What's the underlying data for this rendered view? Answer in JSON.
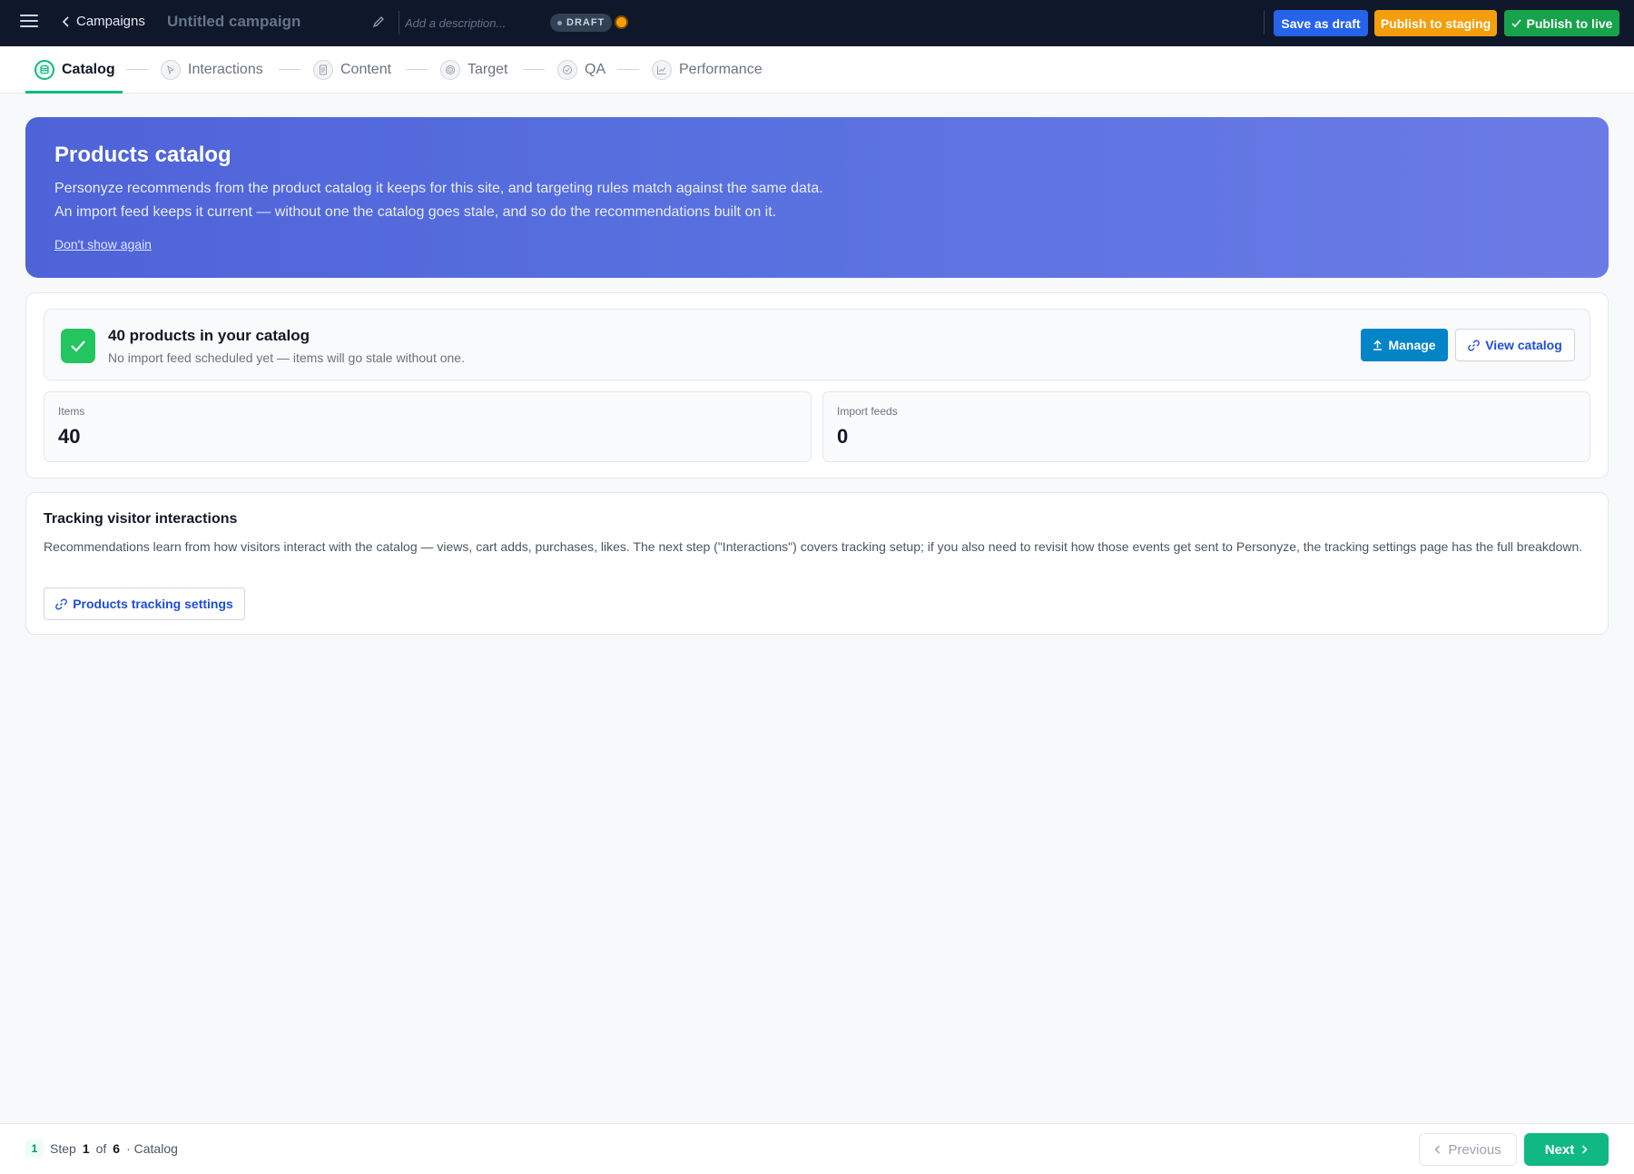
{
  "topbar": {
    "menu_icon": "hamburger-icon",
    "back_label": "Campaigns",
    "campaign_title": "Untitled campaign",
    "description_placeholder": "Add a description...",
    "status_badge": "DRAFT",
    "status_dot_color": "#f59e0b",
    "save_draft_label": "Save as draft",
    "publish_staging_label": "Publish to staging",
    "publish_live_label": "Publish to live",
    "colors": {
      "save_draft": "#2563eb",
      "publish_staging": "#f59e0b",
      "publish_live": "#16a34a"
    }
  },
  "stepper": {
    "active": "Catalog",
    "steps": [
      {
        "label": "Catalog",
        "icon": "database-icon"
      },
      {
        "label": "Interactions",
        "icon": "cursor-icon"
      },
      {
        "label": "Content",
        "icon": "document-icon"
      },
      {
        "label": "Target",
        "icon": "target-icon"
      },
      {
        "label": "QA",
        "icon": "check-circle-icon"
      },
      {
        "label": "Performance",
        "icon": "chart-icon"
      }
    ]
  },
  "hero": {
    "title": "Products catalog",
    "line1": "Personyze recommends from the product catalog it keeps for this site, and targeting rules match against the same data.",
    "line2": "An import feed keeps it current — without one the catalog goes stale, and so do the recommendations built on it.",
    "dismiss_link": "Don't show again"
  },
  "catalog": {
    "status_title": "40 products in your catalog",
    "status_sub": "No import feed scheduled yet — items will go stale without one.",
    "manage_label": "Manage",
    "view_label": "View catalog",
    "stats": [
      {
        "label": "Items",
        "value": "40"
      },
      {
        "label": "Import feeds",
        "value": "0"
      }
    ]
  },
  "tracking": {
    "title": "Tracking visitor interactions",
    "body": "Recommendations learn from how visitors interact with the catalog — views, cart adds, purchases, likes. The next step (\"Interactions\") covers tracking setup; if you also need to revisit how those events get sent to Personyze, the tracking settings page has the full breakdown.",
    "button_label": "Products tracking settings"
  },
  "footer": {
    "step_number": "1",
    "step_word": "Step",
    "current": "1",
    "of_word": "of",
    "total": "6",
    "step_name": "· Catalog",
    "previous_label": "Previous",
    "next_label": "Next"
  }
}
